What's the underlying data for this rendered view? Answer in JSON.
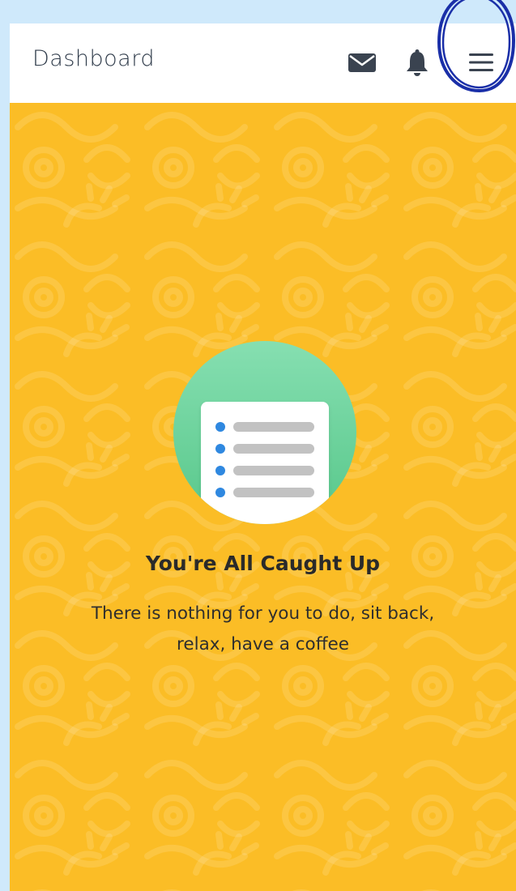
{
  "header": {
    "title": "Dashboard",
    "icons": {
      "mail": "mail-icon",
      "bell": "bell-icon",
      "menu": "hamburger-menu-icon"
    }
  },
  "empty_state": {
    "heading": "You're All Caught Up",
    "message": "There is nothing for you to do, sit back, relax, have a coffee",
    "illustration": "checklist-document-icon"
  },
  "colors": {
    "background": "#fbbd26",
    "topbar": "#ffffff",
    "page_border": "#cfe9fb",
    "illustration_green": "#6dd39b",
    "list_dot_blue": "#2f88e0",
    "annotation_circle": "#1a2fa8"
  }
}
